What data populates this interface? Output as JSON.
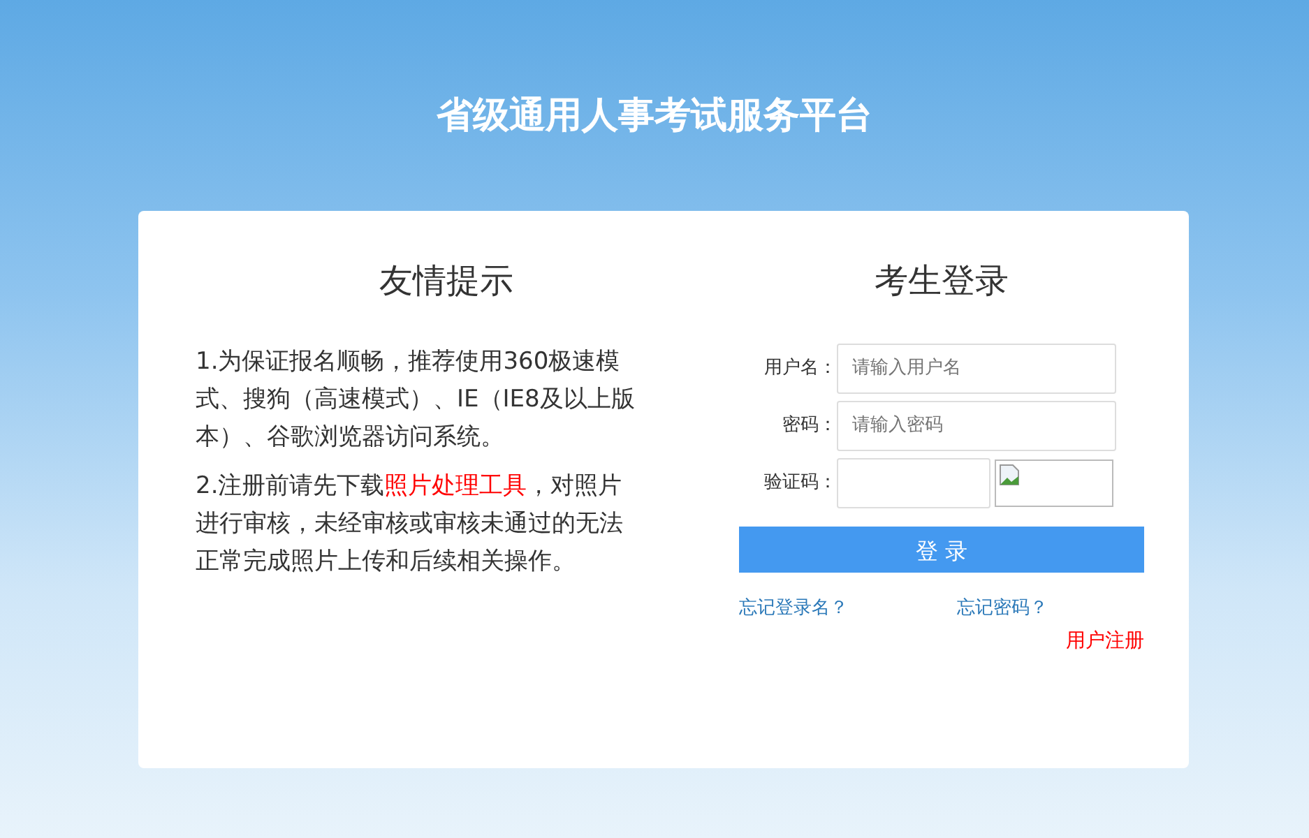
{
  "site_title": "省级通用人事考试服务平台",
  "notice": {
    "title": "友情提示",
    "paragraphs": [
      [
        {
          "text": "1.为保证报名顺畅，推荐使用360极速模式、搜狗（高速模式）、IE（IE8及以上版本）、谷歌浏览器访问系统。",
          "kind": "plain"
        }
      ],
      [
        {
          "text": "2.注册前请先下载",
          "kind": "plain"
        },
        {
          "text": "照片处理工具",
          "kind": "link"
        },
        {
          "text": "，对照片进行审核，未经审核或审核未通过的无法正常完成照片上传和后续相关操作。",
          "kind": "plain"
        }
      ]
    ]
  },
  "login": {
    "title": "考生登录",
    "fields": [
      {
        "label": "用户名：",
        "placeholder": "请输入用户名",
        "kind": "text"
      },
      {
        "label": "密码：",
        "placeholder": "请输入密码",
        "kind": "password"
      },
      {
        "label": "验证码：",
        "kind": "captcha"
      }
    ],
    "submit": "登 录",
    "links": [
      {
        "text": "忘记登录名？",
        "kind": "help"
      },
      {
        "text": "忘记密码？",
        "kind": "help"
      },
      {
        "text": "用户注册",
        "kind": "register"
      }
    ]
  }
}
